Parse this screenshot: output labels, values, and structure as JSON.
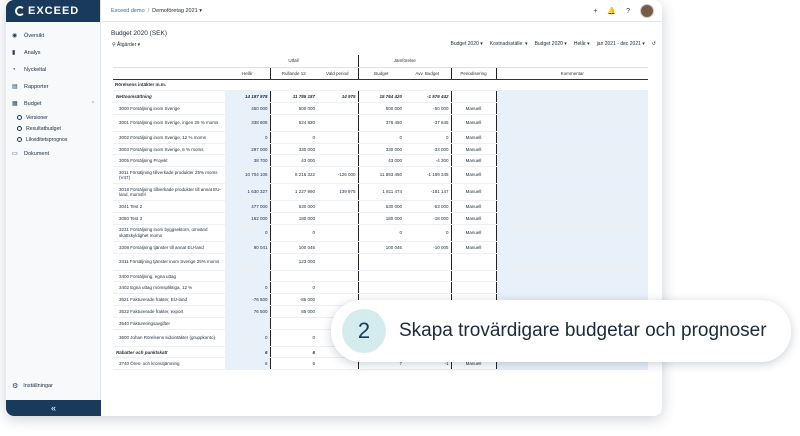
{
  "app": {
    "logo": "EXCEED"
  },
  "sidebar": {
    "items": [
      {
        "label": "Översikt",
        "icon": "circle-icon"
      },
      {
        "label": "Analys",
        "icon": "bar-chart-icon"
      },
      {
        "label": "Nyckeltal",
        "icon": "gauge-icon"
      },
      {
        "label": "Rapporter",
        "icon": "report-icon"
      },
      {
        "label": "Budget",
        "icon": "budget-icon"
      }
    ],
    "budget_sub": [
      "Versioner",
      "Resultatbudget",
      "Likviditetsprognos"
    ],
    "after": {
      "label": "Dokument",
      "icon": "document-icon"
    },
    "settings": "Inställningar",
    "collapse": "«"
  },
  "topbar": {
    "crumb1": "Exceed demo",
    "sep": "/",
    "crumb2": "Demoföretag 2021 ▾",
    "icons": [
      "+",
      "🔔",
      "?"
    ]
  },
  "page": {
    "title": "Budget 2020 (SEK)",
    "actions": "⚲ Åtgärder ▾"
  },
  "filters": [
    "Budget 2020 ▾",
    "Kostnadsställe: ▾",
    "Budget 2020 ▾",
    "Helår ▾",
    "jan 2021 - dec 2021 ▾",
    "↺"
  ],
  "table": {
    "group_headers": {
      "utfall": "Utfall",
      "jamforelse": "Jämförelse"
    },
    "columns": [
      "",
      "Helår",
      "Rullande 12",
      "Vald period",
      "Budget",
      "Avv. Budget",
      "Periodisering",
      "Kommentar"
    ],
    "section": "Rörelsens intäkter m.m.",
    "rows": [
      {
        "label": "Nettoomsättning",
        "helar": "14 187 978",
        "rull": "11 785 187",
        "vald": "14 975",
        "budget": "15 764 420",
        "avv": "-1 576 442",
        "per": "",
        "bold": true
      },
      {
        "label": "3000 Försäljning inom Sverige",
        "helar": "450 000",
        "rull": "500 000",
        "vald": "",
        "budget": "500 000",
        "avv": "-50 000",
        "per": "Manuell"
      },
      {
        "label": "3001 Försäljning inom Sverige, ingen 25 % moms",
        "helar": "338 805",
        "rull": "524 830",
        "vald": "",
        "budget": "376 450",
        "avv": "-37 645",
        "per": "Manuell",
        "tall": true
      },
      {
        "label": "3002 Försäljning inom Sverige, 12 % moms",
        "helar": "0",
        "rull": "0",
        "vald": "",
        "budget": "0",
        "avv": "0",
        "per": "Manuell"
      },
      {
        "label": "3003 Försäljning inom Sverige, 6 % moms",
        "helar": "297 000",
        "rull": "330 000",
        "vald": "",
        "budget": "330 000",
        "avv": "-33 000",
        "per": "Manuell"
      },
      {
        "label": "3005 Försäljning Projekt",
        "helar": "38 700",
        "rull": "43 000",
        "vald": "",
        "budget": "43 000",
        "avv": "-4 300",
        "per": "Manuell"
      },
      {
        "label": "3011 Försäljning tillverkade produkter 25% moms (V47)",
        "helar": "10 704 105",
        "rull": "8 216 322",
        "vald": "-126 000",
        "budget": "11 893 450",
        "avv": "-1 189 345",
        "per": "Manuell",
        "tall": true
      },
      {
        "label": "3018 Försäljning tillverkade produkter till annat EU-land, momsfri",
        "helar": "1 630 327",
        "rull": "1 227 990",
        "vald": "139 975",
        "budget": "1 811 474",
        "avv": "-181 147",
        "per": "Manuell",
        "tall": true
      },
      {
        "label": "3041 Test 2",
        "helar": "477 000",
        "rull": "530 000",
        "vald": "",
        "budget": "530 000",
        "avv": "-53 000",
        "per": "Manuell"
      },
      {
        "label": "3050 Test 3",
        "helar": "162 000",
        "rull": "180 000",
        "vald": "",
        "budget": "180 000",
        "avv": "-18 000",
        "per": "Manuell"
      },
      {
        "label": "3231 Försäljning inom byggsektorn, omvänd skattskyldighet moms",
        "helar": "0",
        "rull": "0",
        "vald": "",
        "budget": "0",
        "avv": "0",
        "per": "Manuell",
        "tall": true
      },
      {
        "label": "3308 Försäljning tjänster till annat EU-land",
        "helar": "90 041",
        "rull": "100 046",
        "vald": "",
        "budget": "100 046",
        "avv": "-10 005",
        "per": "Manuell"
      },
      {
        "label": "3311 Försäljning tjänster inom Sverige 25% moms",
        "helar": "",
        "rull": "123 000",
        "vald": "",
        "budget": "",
        "avv": "",
        "per": "",
        "tall": true
      },
      {
        "label": "3400 Försäljning, egna uttag",
        "helar": "",
        "rull": "",
        "vald": "",
        "budget": "",
        "avv": "",
        "per": ""
      },
      {
        "label": "3402 Egna uttag momspliktiga, 12 %",
        "helar": "0",
        "rull": "0",
        "vald": "",
        "budget": "",
        "avv": "",
        "per": ""
      },
      {
        "label": "3521 Fakturerade frakter, EU-land",
        "helar": "-76 500",
        "rull": "-85 000",
        "vald": "",
        "budget": "",
        "avv": "",
        "per": ""
      },
      {
        "label": "3522 Fakturerade frakter, export",
        "helar": "76 500",
        "rull": "85 000",
        "vald": "",
        "budget": "",
        "avv": "",
        "per": ""
      },
      {
        "label": "3540 Faktureringsavgifter",
        "helar": "",
        "rull": "",
        "vald": "",
        "budget": "",
        "avv": "",
        "per": ""
      },
      {
        "label": "3600 Johan Rörelsens sidointäkter (gruppkonto)",
        "helar": "0",
        "rull": "0",
        "vald": "-35 000",
        "budget": "0",
        "avv": "0",
        "per": "",
        "tall": true
      },
      {
        "label": "Rabatter och punktskatt",
        "helar": "6",
        "rull": "6",
        "vald": "0",
        "budget": "7",
        "avv": "-1",
        "per": "",
        "bold": true
      },
      {
        "label": "3740 Öres- och kronutjämning",
        "helar": "6",
        "rull": "6",
        "vald": "",
        "budget": "7",
        "avv": "-1",
        "per": "Manuell"
      }
    ]
  },
  "callout": {
    "number": "2",
    "text": "Skapa trovärdigare budgetar och prognoser"
  }
}
